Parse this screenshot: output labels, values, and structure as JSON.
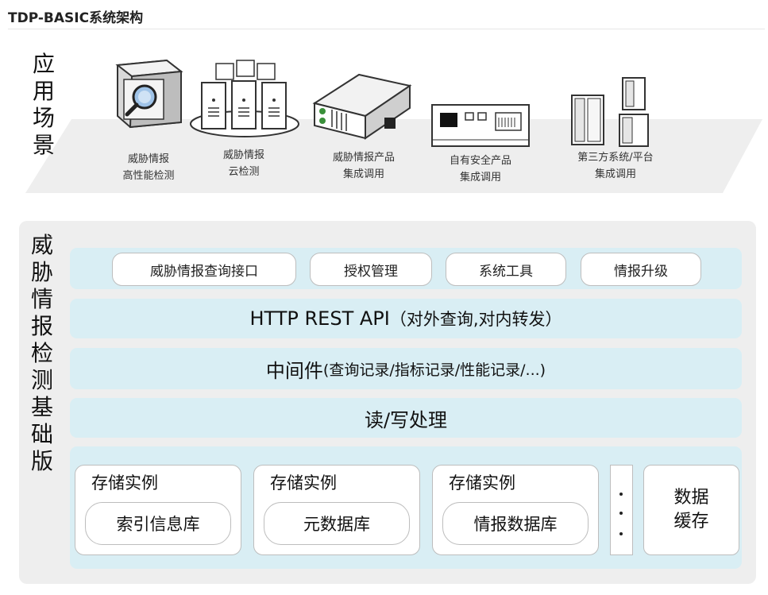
{
  "page_title": "TDP-BASIC系统架构",
  "app_layer": {
    "label": [
      "应",
      "用",
      "场",
      "景"
    ],
    "items": [
      {
        "line1": "威胁情报",
        "line2": "高性能检测",
        "icon": "magnifier-appliance-icon"
      },
      {
        "line1": "威胁情报",
        "line2": "云检测",
        "icon": "server-cluster-icon"
      },
      {
        "line1": "威胁情报产品",
        "line2": "集成调用",
        "icon": "network-appliance-icon"
      },
      {
        "line1": "自有安全产品",
        "line2": "集成调用",
        "icon": "security-device-icon"
      },
      {
        "line1": "第三方系统/平台",
        "line2": "集成调用",
        "icon": "third-party-servers-icon"
      }
    ]
  },
  "base_layer": {
    "label": [
      "威",
      "胁",
      "情",
      "报",
      "检",
      "测",
      "基",
      "础",
      "版"
    ],
    "interfaces": [
      "威胁情报查询接口",
      "授权管理",
      "系统工具",
      "情报升级"
    ],
    "api": {
      "main": "HTTP REST API",
      "sub": "（对外查询,对内转发）"
    },
    "middleware": {
      "main": "中间件",
      "sub": "(查询记录/指标记录/性能记录/...)"
    },
    "rw": "读/写处理",
    "storage": [
      {
        "title": "存储实例",
        "db": "索引信息库"
      },
      {
        "title": "存储实例",
        "db": "元数据库"
      },
      {
        "title": "存储实例",
        "db": "情报数据库"
      }
    ],
    "cache": [
      "数据",
      "缓存"
    ]
  }
}
